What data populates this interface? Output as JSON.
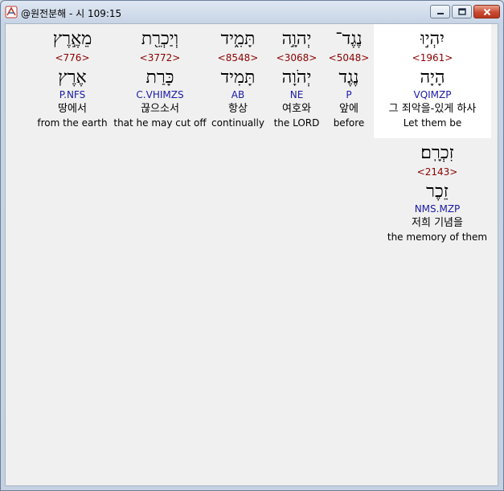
{
  "window": {
    "title": "@원전분해 - 시 109:15",
    "buttons": {
      "minimize": "minimize",
      "maximize": "maximize",
      "close": "close"
    }
  },
  "words": [
    {
      "hebrew": "יִהְי֣וּ",
      "strong": "<1961>",
      "lemma": "הָיָה",
      "morph": "VQIMZP",
      "korean": "그 죄악을-있게 하사",
      "english": "Let them be"
    },
    {
      "hebrew": "נֶגֶד־",
      "strong": "<5048>",
      "lemma": "נֶגֶד",
      "morph": "P",
      "korean": "앞에",
      "english": "before"
    },
    {
      "hebrew": "יְהוָ֣ה",
      "strong": "<3068>",
      "lemma": "יְהֹוָה",
      "morph": "NE",
      "korean": "여호와",
      "english": "the LORD"
    },
    {
      "hebrew": "תָּמִ֑יד",
      "strong": "<8548>",
      "lemma": "תָּמִיד",
      "morph": "AB",
      "korean": "항상",
      "english": "continually"
    },
    {
      "hebrew": "וְיַכְרֵ֖ת",
      "strong": "<3772>",
      "lemma": "כָּרַת",
      "morph": "C.VHIMZS",
      "korean": "끊으소서",
      "english": "that he may cut off"
    },
    {
      "hebrew": "מֵאֶ֣רֶץ",
      "strong": "<776>",
      "lemma": "אֶרֶץ",
      "morph": "P.NFS",
      "korean": "땅에서",
      "english": "from the earth"
    },
    {
      "hebrew": "זִכְרָֽם׃",
      "strong": "<2143>",
      "lemma": "זֵכֶר",
      "morph": "NMS.MZP",
      "korean": "저희 기념을",
      "english": "the memory of them"
    }
  ]
}
